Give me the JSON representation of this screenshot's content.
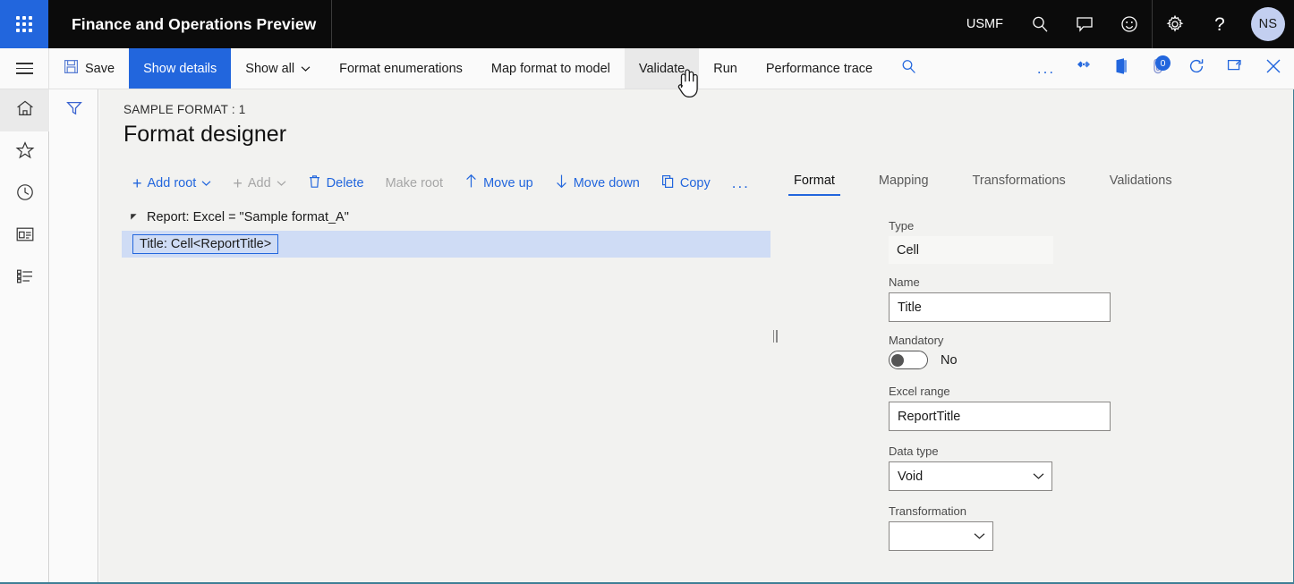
{
  "topbar": {
    "waffle_label": "App launcher",
    "app_title": "Finance and Operations Preview",
    "company": "USMF",
    "search_icon": "search-icon",
    "feedback_icon": "comment-icon",
    "smiley_icon": "smiley-icon",
    "settings_icon": "gear-icon",
    "help_icon": "question-icon",
    "avatar_initials": "NS"
  },
  "commandbar": {
    "menu_icon": "hamburger-icon",
    "save_label": "Save",
    "save_icon": "save-disk-icon",
    "show_details_label": "Show details",
    "show_all_label": "Show all",
    "format_enumerations_label": "Format enumerations",
    "map_format_to_model_label": "Map format to model",
    "validate_label": "Validate",
    "run_label": "Run",
    "performance_trace_label": "Performance trace",
    "search_icon": "search-icon",
    "overflow_label": "...",
    "share_icon": "diamond-share-icon",
    "office_icon": "office-app-icon",
    "attachments_icon": "attachment-icon",
    "attachments_count": "0",
    "refresh_icon": "refresh-icon",
    "popout_icon": "open-in-new-window-icon",
    "close_icon": "close-icon"
  },
  "rail": {
    "items": [
      {
        "name": "home",
        "icon": "home-icon",
        "active": true
      },
      {
        "name": "favorites",
        "icon": "star-icon",
        "active": false
      },
      {
        "name": "recent",
        "icon": "clock-icon",
        "active": false
      },
      {
        "name": "workspaces",
        "icon": "workspace-icon",
        "active": false
      },
      {
        "name": "modules",
        "icon": "list-icon",
        "active": false
      }
    ]
  },
  "filter_pane": {
    "filter_icon": "filter-funnel-icon"
  },
  "page": {
    "breadcrumb": "SAMPLE FORMAT : 1",
    "title": "Format designer"
  },
  "tree_toolbar": {
    "add_root_label": "Add root",
    "add_label": "Add",
    "delete_label": "Delete",
    "make_root_label": "Make root",
    "move_up_label": "Move up",
    "move_down_label": "Move down",
    "copy_label": "Copy",
    "overflow_label": "...",
    "delete_icon": "trash-icon",
    "move_up_icon": "arrow-up-icon",
    "move_down_icon": "arrow-down-icon",
    "copy_icon": "copy-pages-icon"
  },
  "tree": {
    "nodes": [
      {
        "label": "Report: Excel = \"Sample format_A\"",
        "level": 0,
        "expanded": true,
        "selected": false
      },
      {
        "label": "Title: Cell<ReportTitle>",
        "level": 1,
        "expanded": false,
        "selected": true
      }
    ]
  },
  "right_panel": {
    "tabs": [
      {
        "label": "Format",
        "active": true
      },
      {
        "label": "Mapping",
        "active": false
      },
      {
        "label": "Transformations",
        "active": false
      },
      {
        "label": "Validations",
        "active": false
      }
    ],
    "fields": {
      "type_label": "Type",
      "type_value": "Cell",
      "name_label": "Name",
      "name_value": "Title",
      "mandatory_label": "Mandatory",
      "mandatory_value": "No",
      "excel_range_label": "Excel range",
      "excel_range_value": "ReportTitle",
      "data_type_label": "Data type",
      "data_type_value": "Void",
      "transformation_label": "Transformation",
      "transformation_value": ""
    }
  },
  "colors": {
    "accent": "#2266dd",
    "topbar_bg": "#0b0b0b",
    "content_bg": "#f2f2f0",
    "selection_bg": "#cfdcf5",
    "bottom_rule": "#3f7e95"
  }
}
